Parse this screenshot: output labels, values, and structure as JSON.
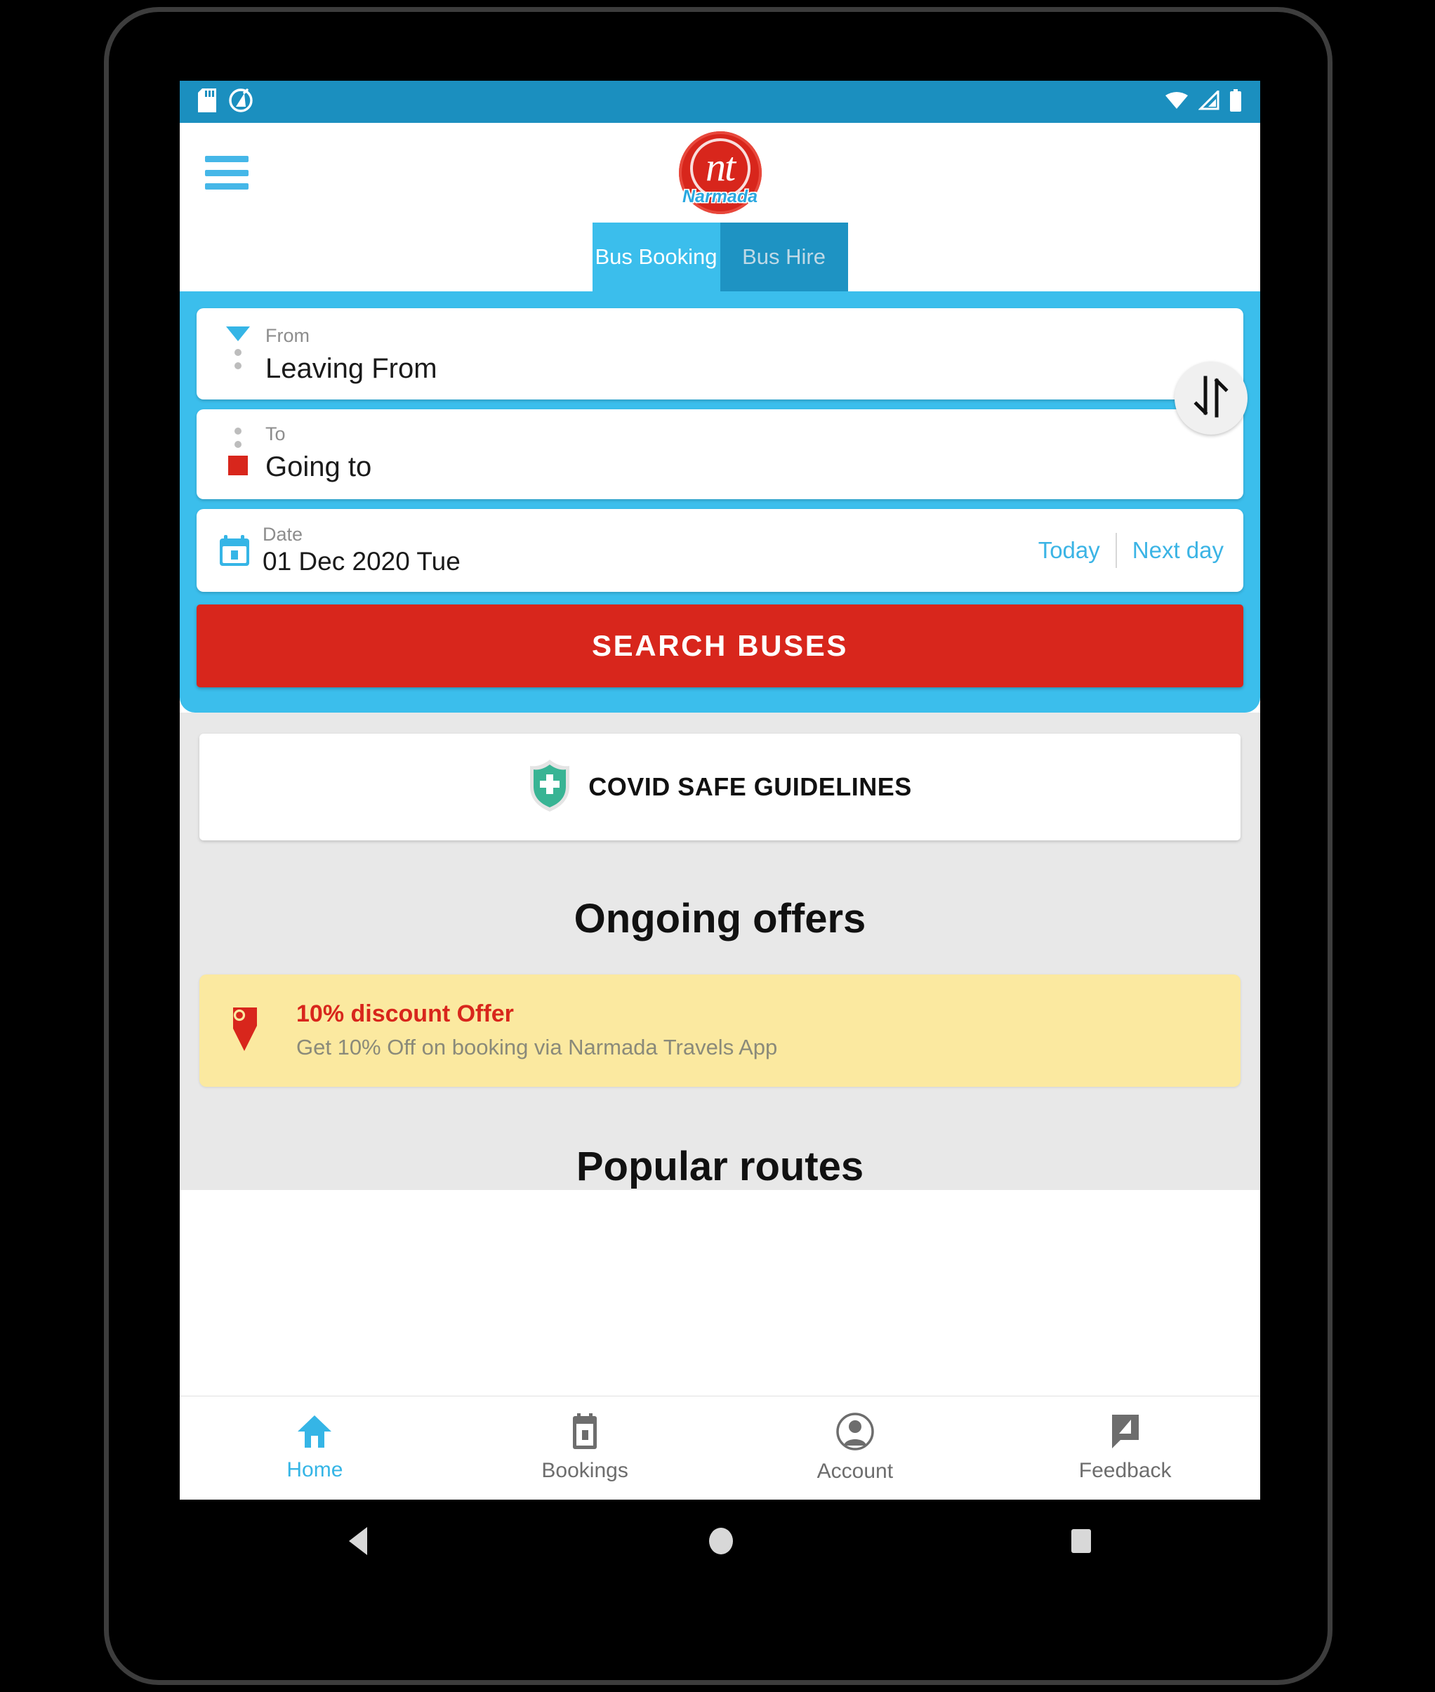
{
  "status_bar": {
    "left_icons": [
      "sd-card-icon",
      "circle-slash-icon"
    ],
    "right_icons": [
      "wifi-icon",
      "cellular-signal-icon",
      "battery-icon"
    ],
    "background": "#1b8fbf"
  },
  "app_bar": {
    "menu_icon": "hamburger-menu-icon",
    "logo": {
      "monogram": "nt",
      "wordmark": "Narmada",
      "disc_color": "#d8261c",
      "wordmark_color": "#2aa8e0"
    }
  },
  "tabs": [
    {
      "label": "Bus Booking",
      "active": true
    },
    {
      "label": "Bus Hire",
      "active": false
    }
  ],
  "search": {
    "panel_color": "#3bbeec",
    "from": {
      "label": "From",
      "value": "Leaving From",
      "marker_icon": "triangle-down-marker-icon",
      "marker_color": "#35b5e6"
    },
    "to": {
      "label": "To",
      "value": "Going to",
      "marker_icon": "square-marker-icon",
      "marker_color": "#d8261c"
    },
    "swap_icon": "swap-vertical-arrows-icon",
    "date": {
      "label": "Date",
      "value": "01 Dec 2020 Tue",
      "icon": "calendar-icon",
      "today_label": "Today",
      "next_day_label": "Next day",
      "link_color": "#3bb4e5"
    },
    "submit_label": "SEARCH BUSES",
    "submit_color": "#d8261c"
  },
  "covid": {
    "label": "COVID SAFE GUIDELINES",
    "icon": "shield-cross-icon",
    "shield_color": "#38b494"
  },
  "offers": {
    "section_title": "Ongoing offers",
    "items": [
      {
        "title": "10% discount Offer",
        "subtitle": "Get 10% Off on booking via Narmada Travels App",
        "icon": "price-tag-icon",
        "card_color": "#fbe9a0",
        "title_color": "#d8261c"
      }
    ]
  },
  "popular": {
    "section_title": "Popular routes"
  },
  "bottom_nav": [
    {
      "label": "Home",
      "icon": "home-icon",
      "active": true
    },
    {
      "label": "Bookings",
      "icon": "ticket-icon",
      "active": false
    },
    {
      "label": "Account",
      "icon": "person-icon",
      "active": false
    },
    {
      "label": "Feedback",
      "icon": "feedback-icon",
      "active": false
    }
  ],
  "android_nav": [
    {
      "name": "back-button",
      "icon": "triangle-left-icon"
    },
    {
      "name": "home-button",
      "icon": "circle-icon"
    },
    {
      "name": "recents-button",
      "icon": "square-icon"
    }
  ]
}
